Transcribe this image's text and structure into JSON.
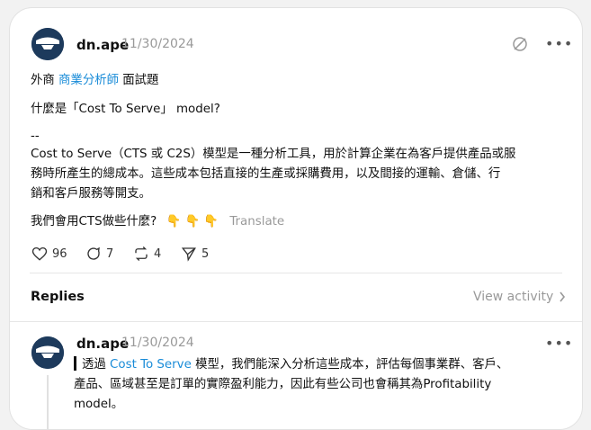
{
  "post": {
    "author": "dn.ape",
    "date": "11/30/2024",
    "line1_prefix": "外商",
    "line1_link": "商業分析師",
    "line1_suffix": "面試題",
    "question": "什麼是「Cost To Serve」 model?",
    "separator": "--",
    "body_line1": "Cost to Serve（CTS 或 C2S）模型是一種分析工具，用於計算企業在為客戶提供產品或服",
    "body_line2": "務時所產生的總成本。這些成本包括直接的生產或採購費用，以及間接的運輸、倉儲、行",
    "body_line3": "銷和客戶服務等開支。",
    "closing": "我們會用CTS做些什麼?",
    "emojis": "👇 👇 👇",
    "translate": "Translate",
    "likes": "96",
    "comments": "7",
    "reposts": "4",
    "shares": "5"
  },
  "replies_section": {
    "title": "Replies",
    "view_activity": "View activity"
  },
  "reply": {
    "author": "dn.ape",
    "date": "11/30/2024",
    "prefix": "透過",
    "link": "Cost To Serve",
    "line1_rest": "模型，我們能深入分析這些成本，評估每個事業群、客戶、",
    "line2": "產品、區域甚至是訂單的實際盈利能力，因此有些公司也會稱其為Profitability",
    "line3": "model。"
  },
  "colors": {
    "link": "#1a8cd8",
    "muted": "#999999",
    "avatar_bg": "#1d3a5c"
  }
}
